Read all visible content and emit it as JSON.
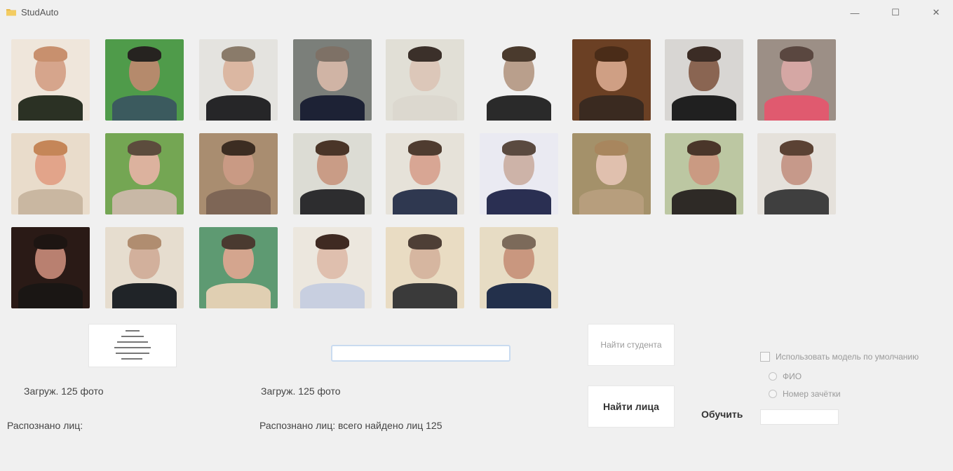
{
  "window": {
    "title": "StudAuto",
    "controls": {
      "minimize": "—",
      "maximize": "☐",
      "close": "✕"
    },
    "icons": {
      "app": "folder-icon",
      "minimize": "minimize-icon",
      "maximize": "maximize-icon",
      "close": "close-icon"
    }
  },
  "gallery": {
    "photos": [
      {
        "bg": "#efe6db",
        "skin": "#d6a58c",
        "hair": "#c8906e",
        "body": "#2b3124"
      },
      {
        "bg": "#4f9b4a",
        "skin": "#b58a6c",
        "hair": "#262320",
        "body": "#3b5a5e"
      },
      {
        "bg": "#e4e3df",
        "skin": "#dbb7a2",
        "hair": "#8a7b6a",
        "body": "#262628"
      },
      {
        "bg": "#7b7f7a",
        "skin": "#d0b4a5",
        "hair": "#7e7166",
        "body": "#1d2235"
      },
      {
        "bg": "#e1dfd6",
        "skin": "#dcc7b9",
        "hair": "#3b302a",
        "body": "#dcd8cf"
      },
      {
        "bg": "#f0f0f0",
        "skin": "#b99f8c",
        "hair": "#4a3a2d",
        "body": "#2a2a2a"
      },
      {
        "bg": "#6b4024",
        "skin": "#cf9f84",
        "hair": "#4a2c18",
        "body": "#3a2a20"
      },
      {
        "bg": "#d8d6d3",
        "skin": "#8a6552",
        "hair": "#3b2c25",
        "body": "#202020"
      },
      {
        "bg": "#9c8f86",
        "skin": "#d5a7a4",
        "hair": "#5a4740",
        "body": "#e05a6f"
      },
      {
        "bg": "#e9dccb",
        "skin": "#e2a48a",
        "hair": "#c58658",
        "body": "#c9b7a1"
      },
      {
        "bg": "#74a653",
        "skin": "#dcb29e",
        "hair": "#5c4c3d",
        "body": "#c8b8a6"
      },
      {
        "bg": "#a98d70",
        "skin": "#c99a84",
        "hair": "#3c2d22",
        "body": "#7e6656"
      },
      {
        "bg": "#dcdcd4",
        "skin": "#c99c86",
        "hair": "#4a3528",
        "body": "#2d2d2f"
      },
      {
        "bg": "#e6e2d9",
        "skin": "#d8a694",
        "hair": "#4f3c30",
        "body": "#2f3850"
      },
      {
        "bg": "#eaeaf2",
        "skin": "#cdb3a8",
        "hair": "#5a4a40",
        "body": "#2a2f52"
      },
      {
        "bg": "#a4916a",
        "skin": "#e0c0ae",
        "hair": "#a8865e",
        "body": "#b79e7d"
      },
      {
        "bg": "#bcc7a2",
        "skin": "#ca9a82",
        "hair": "#4a362a",
        "body": "#2e2a26"
      },
      {
        "bg": "#e5e1db",
        "skin": "#c6998a",
        "hair": "#5b4234",
        "body": "#3f3f3f"
      },
      {
        "bg": "#2a1a16",
        "skin": "#b98070",
        "hair": "#1d1512",
        "body": "#1a1614"
      },
      {
        "bg": "#e6ddcf",
        "skin": "#d2b09c",
        "hair": "#b08d70",
        "body": "#202428"
      },
      {
        "bg": "#5e9a72",
        "skin": "#d4a58e",
        "hair": "#4a3a30",
        "body": "#e0cfb2"
      },
      {
        "bg": "#ece7de",
        "skin": "#dfbfae",
        "hair": "#3f2a22",
        "body": "#c8cfe0"
      },
      {
        "bg": "#e9dcc3",
        "skin": "#d6b6a0",
        "hair": "#4e3f36",
        "body": "#3a3a3a"
      },
      {
        "bg": "#e7dcc4",
        "skin": "#c9977f",
        "hair": "#7c6a5a",
        "body": "#23304b"
      }
    ]
  },
  "preview": {
    "icon": "person-thumbnail-icon"
  },
  "labels": {
    "left_count": "Загруж. 125 фото",
    "middle_count": "Загруж. 125 фото",
    "left_found": "Распознано лиц:",
    "middle_found": "Распознано лиц: всего найдено лиц 125"
  },
  "buttons": {
    "disabled": "Найти студента",
    "main": "Найти лица"
  },
  "side": {
    "label": "Обучить",
    "checkbox_label": "Использовать модель по умолчанию",
    "radio1": "ФИО",
    "radio2": "Номер зачётки"
  }
}
